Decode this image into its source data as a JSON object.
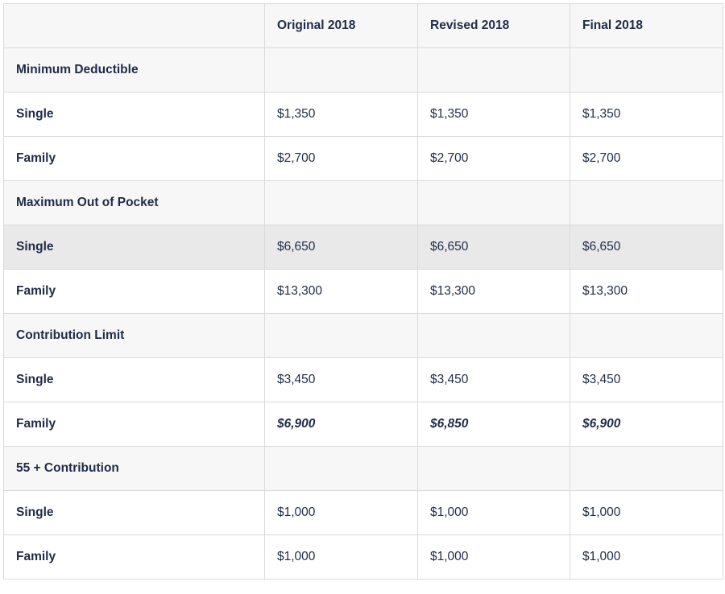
{
  "headers": [
    "",
    "Original 2018",
    "Revised 2018",
    "Final 2018"
  ],
  "rows": [
    {
      "label": "Minimum Deductible",
      "values": [
        "",
        "",
        ""
      ]
    },
    {
      "label": "Single",
      "values": [
        "$1,350",
        "$1,350",
        "$1,350"
      ]
    },
    {
      "label": "Family",
      "values": [
        "$2,700",
        "$2,700",
        "$2,700"
      ]
    },
    {
      "label": "Maximum Out of Pocket",
      "values": [
        "",
        "",
        ""
      ]
    },
    {
      "label": "Single",
      "values": [
        "$6,650",
        "$6,650",
        "$6,650"
      ]
    },
    {
      "label": "Family",
      "values": [
        "$13,300",
        "$13,300",
        "$13,300"
      ]
    },
    {
      "label": "Contribution Limit",
      "values": [
        "",
        "",
        ""
      ]
    },
    {
      "label": "Single",
      "values": [
        "$3,450",
        "$3,450",
        "$3,450"
      ]
    },
    {
      "label": "Family",
      "values": [
        "$6,900",
        "$6,850",
        "$6,900"
      ]
    },
    {
      "label": "55 + Contribution",
      "values": [
        "",
        "",
        ""
      ]
    },
    {
      "label": "Single",
      "values": [
        "$1,000",
        "$1,000",
        "$1,000"
      ]
    },
    {
      "label": "Family",
      "values": [
        "$1,000",
        "$1,000",
        "$1,000"
      ]
    }
  ]
}
